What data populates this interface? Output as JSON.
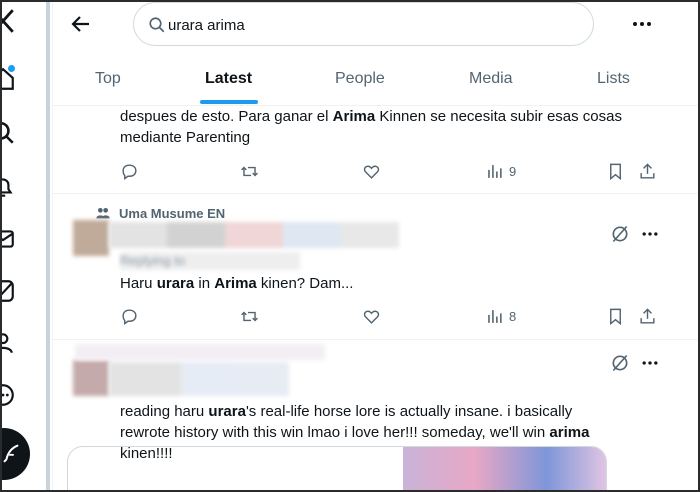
{
  "search": {
    "query": "urara arima"
  },
  "tabs": [
    {
      "label": "Top",
      "active": false
    },
    {
      "label": "Latest",
      "active": true
    },
    {
      "label": "People",
      "active": false
    },
    {
      "label": "Media",
      "active": false
    },
    {
      "label": "Lists",
      "active": false
    }
  ],
  "tweets": [
    {
      "text_lines": [
        [
          "despues de esto. Para ganar el ",
          "Arima",
          " Kinnen se necesita subir esas cosas"
        ],
        [
          "mediante Parenting"
        ]
      ],
      "views": "9"
    },
    {
      "social_context": "Uma Musume EN",
      "reply_hint": "Replying to",
      "text_parts": [
        "Haru ",
        "urara",
        " in ",
        "Arima",
        " kinen? Dam..."
      ],
      "views": "8"
    },
    {
      "text_lines": [
        [
          "reading haru ",
          "urara",
          "'s real-life horse lore is actually insane. i basically"
        ],
        [
          "rewrote history with this win lmao i love her!!! someday, we'll win ",
          "arima"
        ],
        [
          "kinen!!!!"
        ]
      ]
    }
  ],
  "colors": {
    "accent": "#1d9bf0",
    "text": "#0f1419",
    "muted": "#536471",
    "border": "#eff3f4"
  },
  "icons": [
    "x-logo-icon",
    "home-icon",
    "search-icon",
    "bell-icon",
    "mail-icon",
    "grok-icon",
    "profile-icon",
    "more-circle-icon",
    "compose-icon",
    "back-arrow-icon",
    "more-icon",
    "reply-icon",
    "retweet-icon",
    "like-icon",
    "views-icon",
    "bookmark-icon",
    "share-icon",
    "grok-slash-icon",
    "community-icon"
  ]
}
